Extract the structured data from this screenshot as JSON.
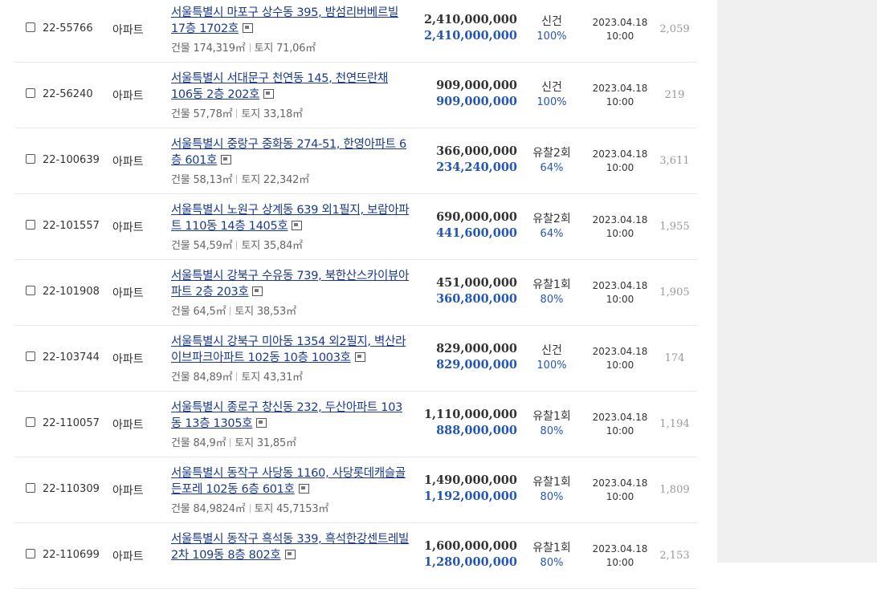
{
  "rows": [
    {
      "case_no": "22-55766",
      "kind": "아파트",
      "address": "서울특별시 마포구 상수동 395, 밤섬리버베르빌 17층 1702호",
      "building_area": "건물 174,319㎡",
      "land_area": "토지 71,06㎡",
      "appraisal_price": "2,410,000,000",
      "minimum_price": "2,410,000,000",
      "status": "신건",
      "rate": "100%",
      "date": "2023.04.18",
      "time": "10:00",
      "views": "2,059"
    },
    {
      "case_no": "22-56240",
      "kind": "아파트",
      "address": "서울특별시 서대문구 천연동 145, 천연뜨란채 106동 2층 202호",
      "building_area": "건물 57,78㎡",
      "land_area": "토지 33,18㎡",
      "appraisal_price": "909,000,000",
      "minimum_price": "909,000,000",
      "status": "신건",
      "rate": "100%",
      "date": "2023.04.18",
      "time": "10:00",
      "views": "219"
    },
    {
      "case_no": "22-100639",
      "kind": "아파트",
      "address": "서울특별시 중랑구 중화동 274-51, 한영아파트 6층 601호",
      "building_area": "건물 58,13㎡",
      "land_area": "토지 22,342㎡",
      "appraisal_price": "366,000,000",
      "minimum_price": "234,240,000",
      "status": "유찰2회",
      "rate": "64%",
      "date": "2023.04.18",
      "time": "10:00",
      "views": "3,611"
    },
    {
      "case_no": "22-101557",
      "kind": "아파트",
      "address": "서울특별시 노원구 상계동 639 외1필지, 보람아파트 110동 14층 1405호",
      "building_area": "건물 54,59㎡",
      "land_area": "토지 35,84㎡",
      "appraisal_price": "690,000,000",
      "minimum_price": "441,600,000",
      "status": "유찰2회",
      "rate": "64%",
      "date": "2023.04.18",
      "time": "10:00",
      "views": "1,955"
    },
    {
      "case_no": "22-101908",
      "kind": "아파트",
      "address": "서울특별시 강북구 수유동 739, 북한산스카이뷰아파트 2층 203호",
      "building_area": "건물 64,5㎡",
      "land_area": "토지 38,53㎡",
      "appraisal_price": "451,000,000",
      "minimum_price": "360,800,000",
      "status": "유찰1회",
      "rate": "80%",
      "date": "2023.04.18",
      "time": "10:00",
      "views": "1,905"
    },
    {
      "case_no": "22-103744",
      "kind": "아파트",
      "address": "서울특별시 강북구 미아동 1354 외2필지, 벽산라이브파크아파트 102동 10층 1003호",
      "building_area": "건물 84,89㎡",
      "land_area": "토지 43,31㎡",
      "appraisal_price": "829,000,000",
      "minimum_price": "829,000,000",
      "status": "신건",
      "rate": "100%",
      "date": "2023.04.18",
      "time": "10:00",
      "views": "174"
    },
    {
      "case_no": "22-110057",
      "kind": "아파트",
      "address": "서울특별시 종로구 창신동 232, 두산아파트 103동 13층 1305호",
      "building_area": "건물 84,9㎡",
      "land_area": "토지 31,85㎡",
      "appraisal_price": "1,110,000,000",
      "minimum_price": "888,000,000",
      "status": "유찰1회",
      "rate": "80%",
      "date": "2023.04.18",
      "time": "10:00",
      "views": "1,194"
    },
    {
      "case_no": "22-110309",
      "kind": "아파트",
      "address": "서울특별시 동작구 사당동 1160, 사당롯데캐슬골든포레 102동 6층 601호",
      "building_area": "건물 84,9824㎡",
      "land_area": "토지 45,7153㎡",
      "appraisal_price": "1,490,000,000",
      "minimum_price": "1,192,000,000",
      "status": "유찰1회",
      "rate": "80%",
      "date": "2023.04.18",
      "time": "10:00",
      "views": "1,809"
    },
    {
      "case_no": "22-110699",
      "kind": "아파트",
      "address": "서울특별시 동작구 흑석동 339, 흑석한강센트레빌2차 109동 8층 802호",
      "building_area": "",
      "land_area": "",
      "appraisal_price": "1,600,000,000",
      "minimum_price": "1,280,000,000",
      "status": "유찰1회",
      "rate": "80%",
      "date": "2023.04.18",
      "time": "10:00",
      "views": "2,153"
    }
  ],
  "icons": {
    "checkbox": "checkbox",
    "map": "map-popup-icon"
  },
  "colors": {
    "link": "#1a3a8e",
    "minimum_price": "#2456b4",
    "side_panel": "#f0f0f0"
  }
}
